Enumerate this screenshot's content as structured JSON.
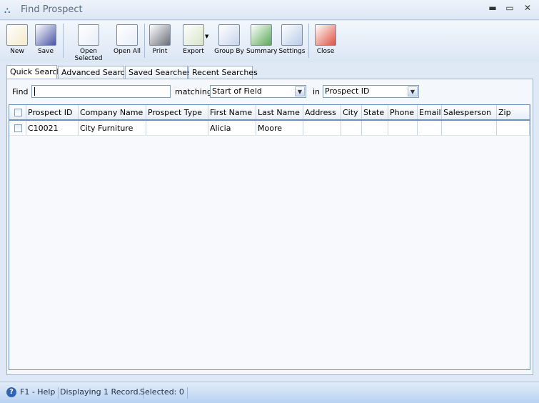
{
  "window": {
    "title": "Find Prospect",
    "minimize": "▬",
    "maximize": "▭",
    "close": "✕"
  },
  "toolbar": [
    {
      "label": "New",
      "icon": "new-icon"
    },
    {
      "label": "Save",
      "icon": "save-icon"
    },
    {
      "label": "Open Selected",
      "icon": "open-selected-icon"
    },
    {
      "label": "Open All",
      "icon": "open-all-icon"
    },
    {
      "label": "Print",
      "icon": "print-icon"
    },
    {
      "label": "Export",
      "icon": "export-icon"
    },
    {
      "label": "Group By",
      "icon": "group-by-icon"
    },
    {
      "label": "Summary",
      "icon": "summary-icon"
    },
    {
      "label": "Settings",
      "icon": "settings-icon"
    },
    {
      "label": "Close",
      "icon": "close-icon"
    }
  ],
  "tabs": [
    {
      "label": "Quick Search"
    },
    {
      "label": "Advanced Search"
    },
    {
      "label": "Saved Searches"
    },
    {
      "label": "Recent Searches"
    }
  ],
  "search": {
    "find_label": "Find",
    "find_value": "",
    "matching_label": "matching",
    "matching_value": "Start of Field",
    "in_label": "in",
    "in_value": "Prospect ID"
  },
  "grid": {
    "columns": [
      "Prospect ID",
      "Company Name",
      "Prospect Type",
      "First Name",
      "Last Name",
      "Address",
      "City",
      "State",
      "Phone",
      "Email",
      "Salesperson",
      "Zip"
    ],
    "rows": [
      [
        "C10021",
        "City Furniture",
        "",
        "Alicia",
        "Moore",
        "",
        "",
        "",
        "",
        "",
        "",
        ""
      ]
    ]
  },
  "status": {
    "help": "F1 - Help",
    "records": "Displaying 1 Record.",
    "selected": "Selected: 0"
  }
}
